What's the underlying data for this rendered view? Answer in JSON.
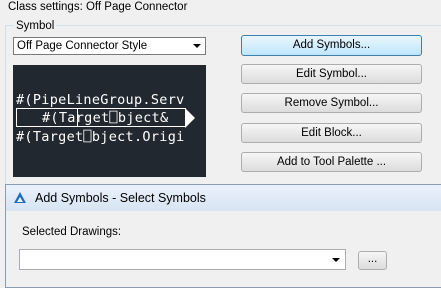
{
  "header": {
    "label": "Class settings: Off Page Connector"
  },
  "symbol_group": {
    "label": "Symbol"
  },
  "style_dropdown": {
    "value": "Off Page Connector Style"
  },
  "preview": {
    "line1": "#(PipeLineGroup.Serv",
    "line2": "#(Target⎕bject&",
    "line3": "#(Target⎕bject.Origi"
  },
  "buttons": {
    "add_symbols": "Add Symbols...",
    "edit_symbol": "Edit Symbol...",
    "remove_symbol": "Remove Symbol...",
    "edit_block": "Edit Block...",
    "add_tool_palette": "Add to Tool Palette ..."
  },
  "dialog": {
    "title": "Add Symbols - Select Symbols",
    "selected_drawings_label": "Selected Drawings:",
    "selected_drawings_value": "",
    "browse_label": "..."
  },
  "colors": {
    "preview_bg": "#212830",
    "accent": "#1f6fb5"
  },
  "icons": {
    "title": "autocad-a-icon",
    "dropdown": "chevron-down-icon"
  }
}
